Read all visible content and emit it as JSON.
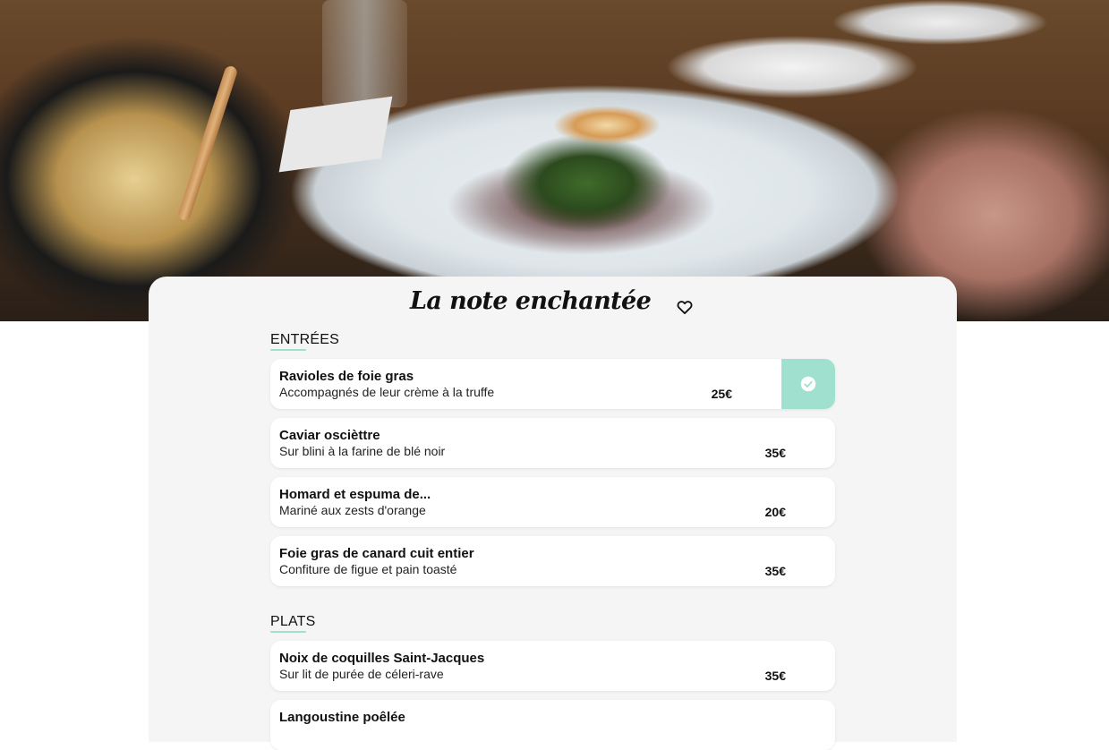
{
  "restaurant": {
    "name": "La note enchantée"
  },
  "icons": {
    "favorite": "heart-outline-icon",
    "selected": "check-circle-icon"
  },
  "colors": {
    "accent": "#9fe0cf",
    "card_bg": "#f5f5f5",
    "item_bg": "#ffffff"
  },
  "sections": [
    {
      "title": "ENTRÉES",
      "items": [
        {
          "name": "Ravioles de foie gras",
          "description": "Accompagnés de leur crème à la truffe",
          "price": "25€",
          "selected": true
        },
        {
          "name": "Caviar oscièttre",
          "description": "Sur blini à la farine de blé noir",
          "price": "35€",
          "selected": false
        },
        {
          "name": "Homard et espuma de...",
          "description": "Mariné aux zests d'orange",
          "price": "20€",
          "selected": false
        },
        {
          "name": "Foie gras de canard cuit entier",
          "description": "Confiture de figue et pain toasté",
          "price": "35€",
          "selected": false
        }
      ]
    },
    {
      "title": "PLATS",
      "items": [
        {
          "name": "Noix de coquilles Saint-Jacques",
          "description": "Sur lit de purée de céleri-rave",
          "price": "35€",
          "selected": false
        },
        {
          "name": "Langoustine poêlée",
          "description": "",
          "price": "",
          "selected": false
        }
      ]
    }
  ]
}
